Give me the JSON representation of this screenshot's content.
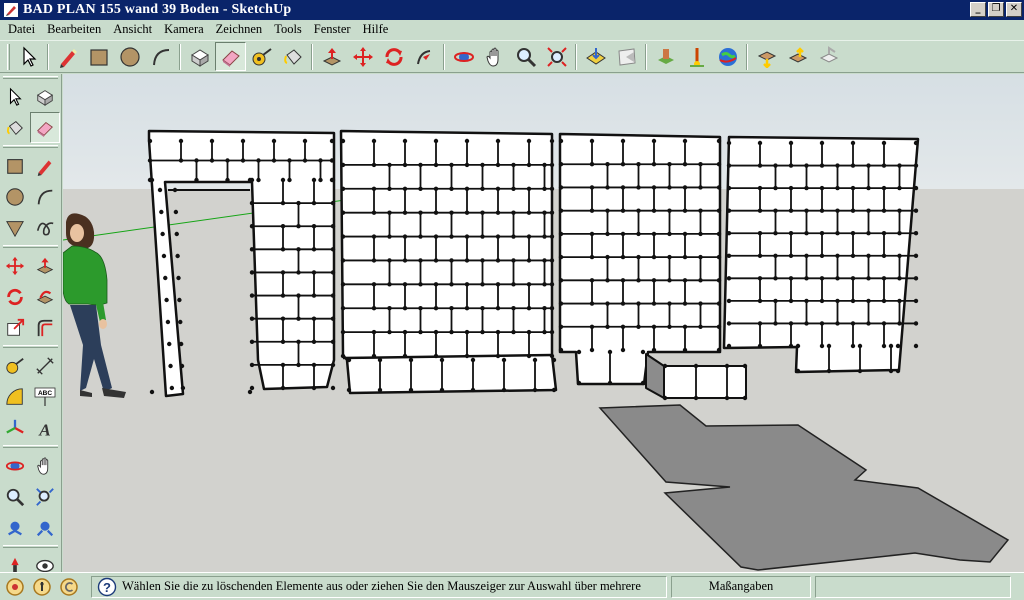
{
  "window": {
    "title": "BAD PLAN 155 wand 39 Boden - SketchUp",
    "minimize_symbol": "_",
    "restore_symbol": "❐",
    "close_symbol": "✕"
  },
  "menu": [
    "Datei",
    "Bearbeiten",
    "Ansicht",
    "Kamera",
    "Zeichnen",
    "Tools",
    "Fenster",
    "Hilfe"
  ],
  "toolbar_icons": {
    "top": [
      "select-icon",
      "pencil-line-icon",
      "rectangle-icon",
      "circle-icon",
      "arc-icon",
      "make-component-icon",
      "eraser-icon",
      "tape-measure-icon",
      "paint-bucket-icon",
      "push-pull-icon",
      "move-icon",
      "rotate-icon",
      "follow-me-icon",
      "orbit-icon",
      "pan-icon",
      "zoom-icon",
      "zoom-extents-icon",
      "get-models-icon",
      "share-model-icon",
      "place-model-icon",
      "google-earth-model-icon",
      "google-earth-icon",
      "get-current-view-icon",
      "toggle-terrain-icon",
      "place-3d-icon"
    ],
    "left": [
      "select-icon",
      "make-component-icon",
      "paint-bucket-icon",
      "eraser-icon",
      "rectangle-icon",
      "line-icon",
      "circle-icon",
      "arc-icon",
      "polygon-icon",
      "freehand-icon",
      "move-icon",
      "push-pull-icon",
      "rotate-icon",
      "follow-me-icon",
      "scale-icon",
      "offset-icon",
      "tape-measure-icon",
      "dimension-icon",
      "protractor-icon",
      "text-icon",
      "axes-icon",
      "3d-text-icon",
      "orbit-icon",
      "pan-icon",
      "zoom-icon",
      "zoom-window-icon",
      "previous-view-icon",
      "zoom-extents-icon",
      "position-camera-icon",
      "look-around-icon",
      "walk-icon",
      "section-plane-icon"
    ]
  },
  "status": {
    "message": "Wählen Sie die zu löschenden Elemente aus oder ziehen Sie den Mauszeiger zur Auswahl über mehrere",
    "measurements_label": "Maßangaben",
    "measurements_value": "",
    "help_symbol": "?"
  }
}
